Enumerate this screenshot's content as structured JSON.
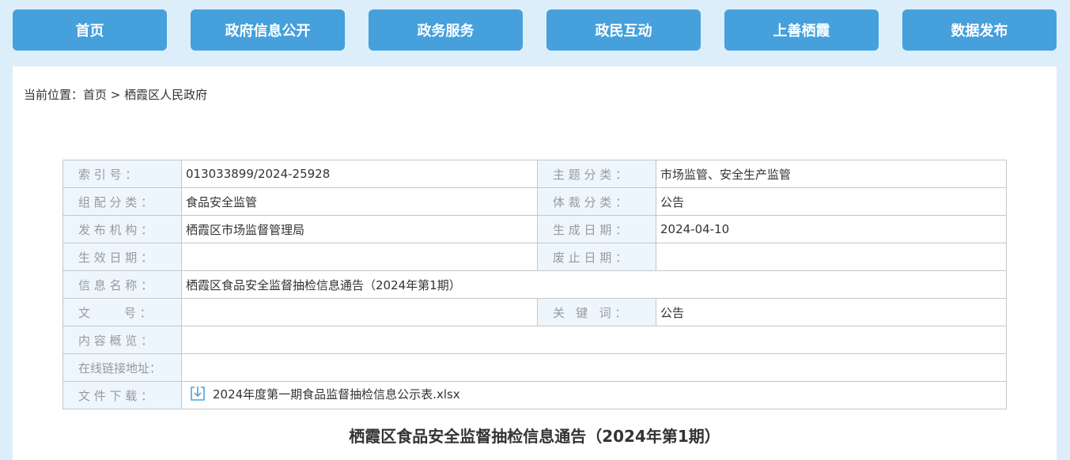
{
  "nav": {
    "items": [
      {
        "label": "首页"
      },
      {
        "label": "政府信息公开"
      },
      {
        "label": "政务服务"
      },
      {
        "label": "政民互动"
      },
      {
        "label": "上善栖霞"
      },
      {
        "label": "数据发布"
      }
    ]
  },
  "breadcrumb": {
    "prefix": "当前位置：",
    "home": "首页",
    "separator": " > ",
    "current": "栖霞区人民政府"
  },
  "info": {
    "index_label": "索 引 号 ：",
    "index_value": "013033899/2024-25928",
    "topic_label": "主 题 分 类 ：",
    "topic_value": "市场监管、安全生产监管",
    "org_category_label": "组 配 分 类 ：",
    "org_category_value": "食品安全监管",
    "genre_label": "体 裁 分 类 ：",
    "genre_value": "公告",
    "publisher_label": "发 布 机 构 ：",
    "publisher_value": "栖霞区市场监督管理局",
    "created_label": "生 成 日 期 ：",
    "created_value": "2024-04-10",
    "effective_label": "生 效 日 期 ：",
    "effective_value": "",
    "abolished_label": "废 止 日 期 ：",
    "abolished_value": "",
    "name_label": "信 息 名 称 ：",
    "name_value": "栖霞区食品安全监督抽检信息通告（2024年第1期）",
    "docno_label": "文         号 ：",
    "docno_value": "",
    "keywords_label": "关   键   词 ：",
    "keywords_value": "公告",
    "summary_label": "内 容 概 览 ：",
    "summary_value": "",
    "link_label": "在线链接地址：",
    "link_value": "",
    "download_label": "文 件 下 载 ：",
    "download_file": "2024年度第一期食品监督抽检信息公示表.xlsx",
    "download_icon": "download-file-icon"
  },
  "page_title": "栖霞区食品安全监督抽检信息通告（2024年第1期）",
  "colors": {
    "background": "#dceefa",
    "nav_button": "#45a0dc",
    "label_cell_bg": "#eef6fd",
    "border": "#c6c6c6"
  }
}
